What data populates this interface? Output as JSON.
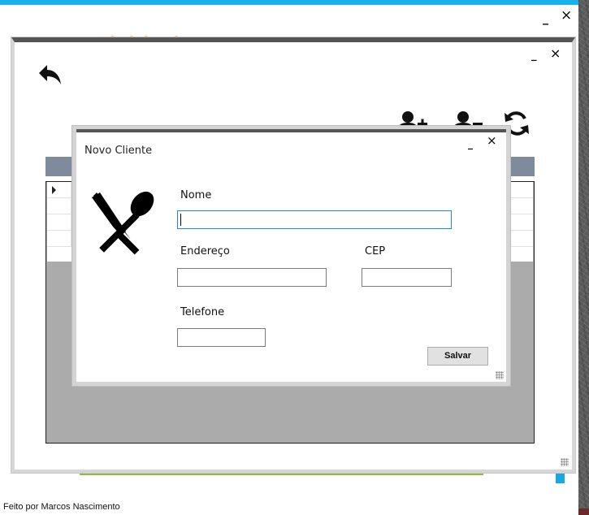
{
  "main_window": {
    "brand_title": "Sanduícheria",
    "minimize_label": "_",
    "close_label": "×",
    "footer": "Feito por Marcos Nascimento"
  },
  "clients_window": {
    "minimize_label": "_",
    "close_label": "×",
    "toolbar": [
      "back-arrow-icon",
      "add-user-icon",
      "remove-user-icon",
      "refresh-icon"
    ],
    "grid_rows": 4
  },
  "dialog": {
    "title": "Novo Cliente",
    "minimize_label": "_",
    "close_label": "×",
    "nome_label": "Nome",
    "nome_value": "",
    "endereco_label": "Endereço",
    "endereco_value": "",
    "cep_label": "CEP",
    "cep_value": "",
    "telefone_label": "Telefone",
    "telefone_value": "",
    "save_label": "Salvar",
    "icon": "cutlery-icon"
  },
  "colors": {
    "accent_blue": "#1ab0ea",
    "brand_orange": "#f07f14",
    "grid_header": "#7d8b9d",
    "grid_bg": "#ababab",
    "green_line": "#8cbe3a",
    "title_bar_dark": "#555555"
  }
}
